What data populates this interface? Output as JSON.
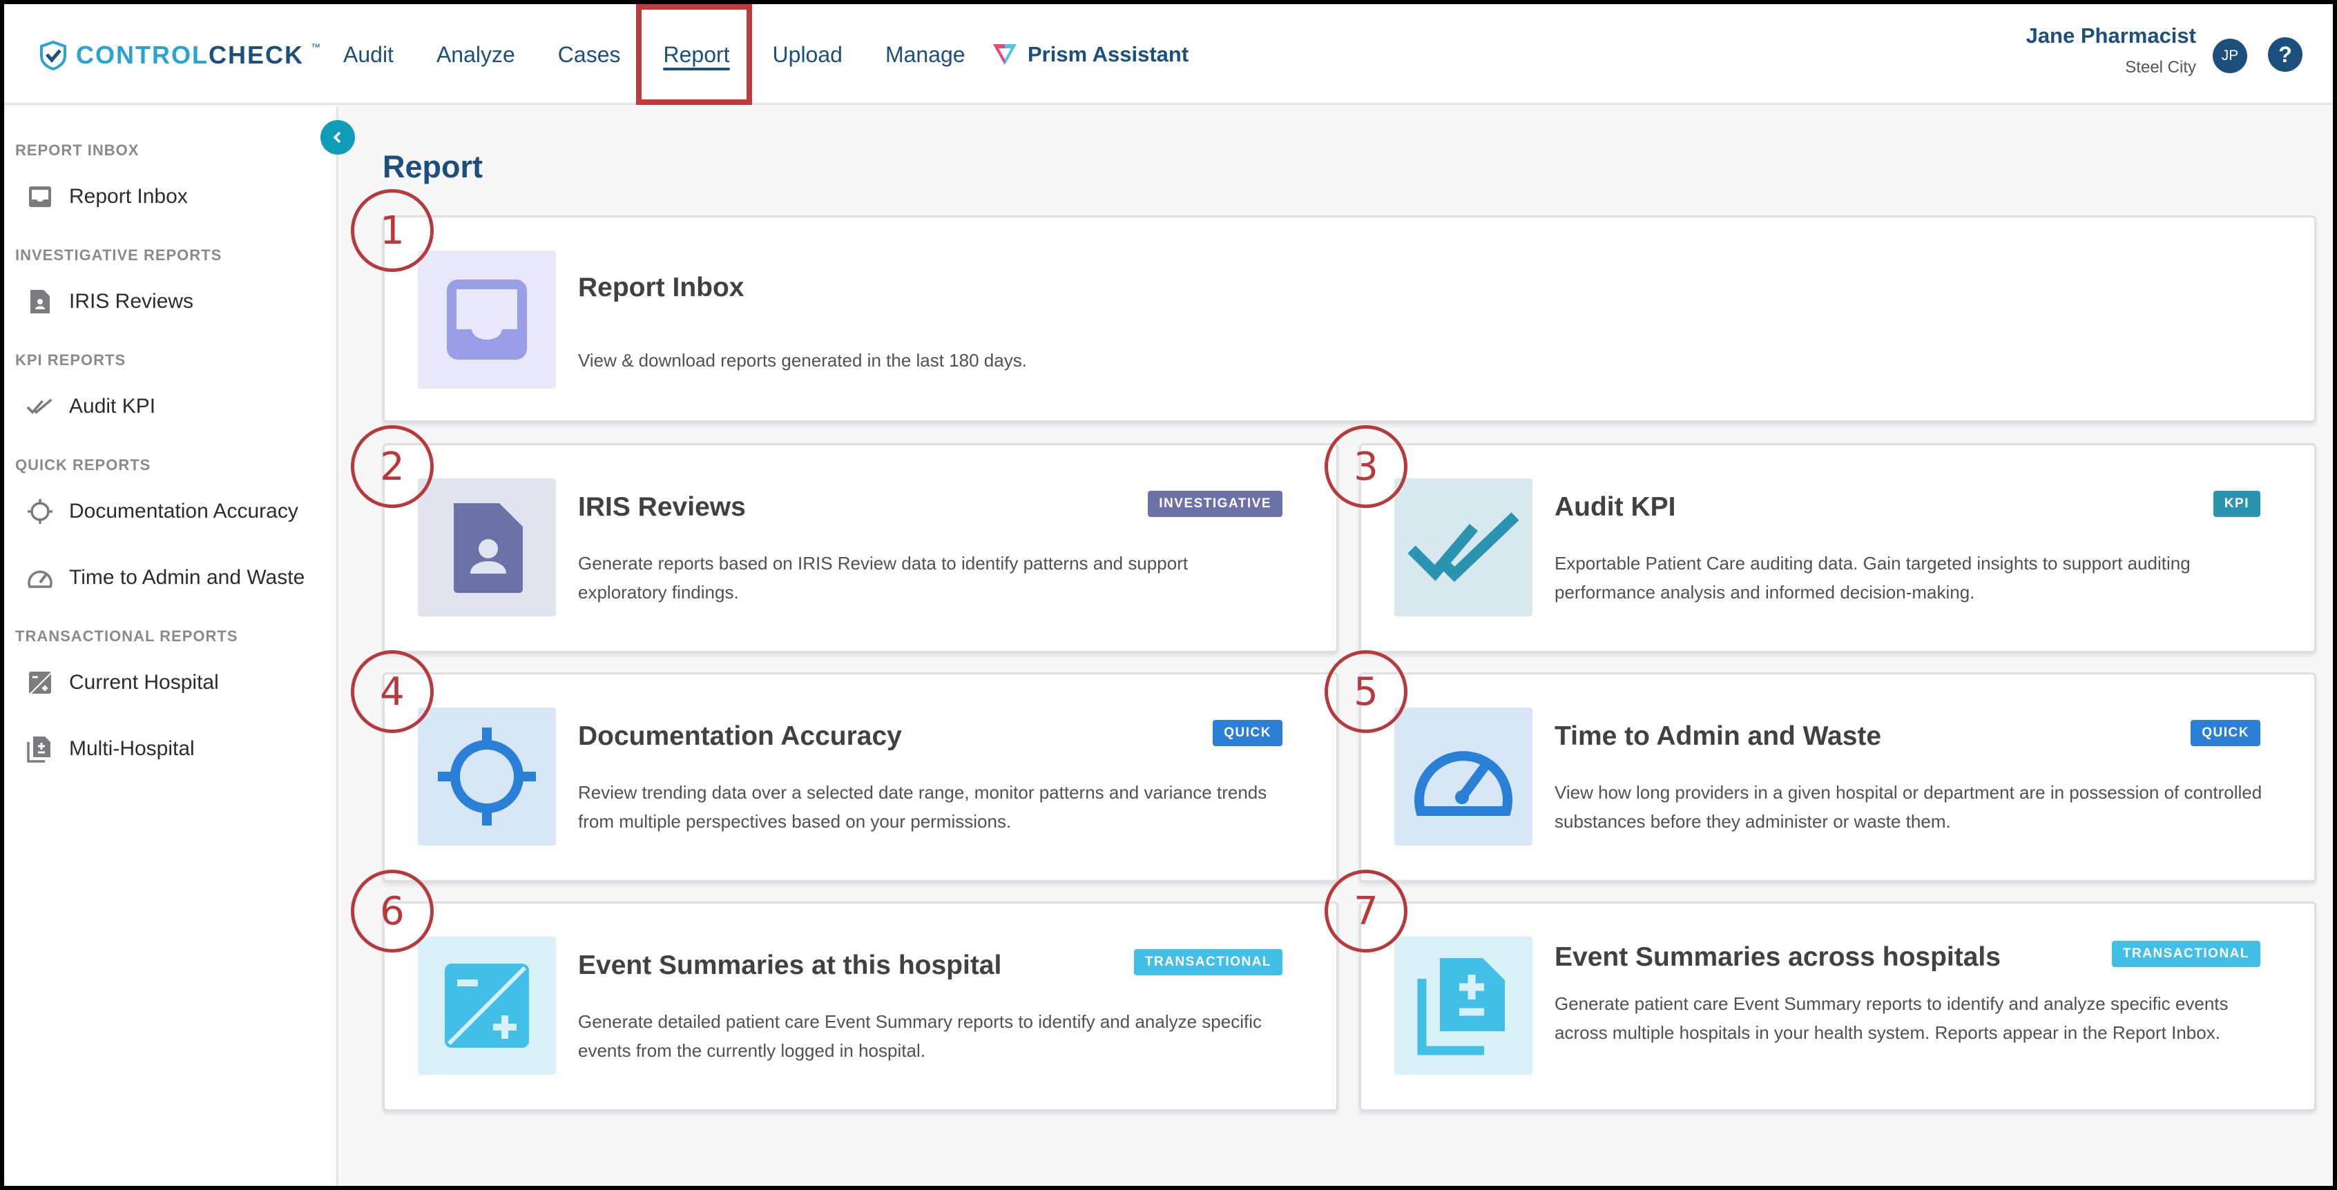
{
  "brand": {
    "name_light": "CONTROL",
    "name_bold": "CHECK",
    "tm": "™"
  },
  "nav": [
    {
      "label": "Audit"
    },
    {
      "label": "Analyze"
    },
    {
      "label": "Cases"
    },
    {
      "label": "Report",
      "active": true
    },
    {
      "label": "Upload"
    },
    {
      "label": "Manage"
    }
  ],
  "assistant": {
    "label": "Prism Assistant"
  },
  "user": {
    "name": "Jane Pharmacist",
    "location": "Steel City",
    "initials": "JP"
  },
  "help": {
    "label": "?"
  },
  "sidebar": {
    "sections": [
      {
        "title": "REPORT INBOX",
        "items": [
          {
            "label": "Report Inbox",
            "icon": "inbox-icon"
          }
        ]
      },
      {
        "title": "INVESTIGATIVE REPORTS",
        "items": [
          {
            "label": "IRIS Reviews",
            "icon": "user-file-icon"
          }
        ]
      },
      {
        "title": "KPI REPORTS",
        "items": [
          {
            "label": "Audit KPI",
            "icon": "double-check-icon"
          }
        ]
      },
      {
        "title": "QUICK REPORTS",
        "items": [
          {
            "label": "Documentation Accuracy",
            "icon": "crosshair-icon"
          },
          {
            "label": "Time to Admin and Waste",
            "icon": "gauge-icon"
          }
        ]
      },
      {
        "title": "TRANSACTIONAL REPORTS",
        "items": [
          {
            "label": "Current Hospital",
            "icon": "plus-minus-icon"
          },
          {
            "label": "Multi-Hospital",
            "icon": "stacked-docs-icon"
          }
        ]
      }
    ]
  },
  "page": {
    "title": "Report"
  },
  "cards": [
    {
      "num": "1",
      "title": "Report Inbox",
      "desc": "View & download reports generated in the last 180 days.",
      "badge": "",
      "icon": "inbox-icon"
    },
    {
      "num": "2",
      "title": "IRIS Reviews",
      "desc": "Generate reports based on IRIS Review data to identify patterns and support exploratory findings.",
      "badge": "INVESTIGATIVE",
      "icon": "user-file-icon"
    },
    {
      "num": "3",
      "title": "Audit KPI",
      "desc": "Exportable Patient Care auditing data. Gain targeted insights to support auditing performance analysis and informed decision-making.",
      "badge": "KPI",
      "icon": "double-check-icon"
    },
    {
      "num": "4",
      "title": "Documentation Accuracy",
      "desc": "Review trending data over a selected date range, monitor patterns and variance trends from multiple perspectives based on your permissions.",
      "badge": "QUICK",
      "icon": "crosshair-icon"
    },
    {
      "num": "5",
      "title": "Time to Admin and Waste",
      "desc": "View how long providers in a given hospital or department are in possession of controlled substances before they administer or waste them.",
      "badge": "QUICK",
      "icon": "gauge-icon"
    },
    {
      "num": "6",
      "title": "Event Summaries at this hospital",
      "desc": "Generate detailed patient care Event Summary reports to identify and analyze specific events from the currently logged in hospital.",
      "badge": "TRANSACTIONAL",
      "icon": "plus-minus-icon"
    },
    {
      "num": "7",
      "title": "Event Summaries across hospitals",
      "desc": "Generate patient care Event Summary reports to identify and analyze specific events across multiple hospitals in your health system. Reports appear in the Report Inbox.",
      "badge": "TRANSACTIONAL",
      "icon": "stacked-docs-icon"
    }
  ],
  "colors": {
    "navy": "#1c4f7c",
    "teal": "#0f9cb8",
    "highlight": "#c0393d",
    "badge_investigative": "#6c72a8",
    "badge_kpi": "#2b94b0",
    "badge_quick": "#2a7fd6",
    "badge_transactional": "#42bfe6"
  }
}
